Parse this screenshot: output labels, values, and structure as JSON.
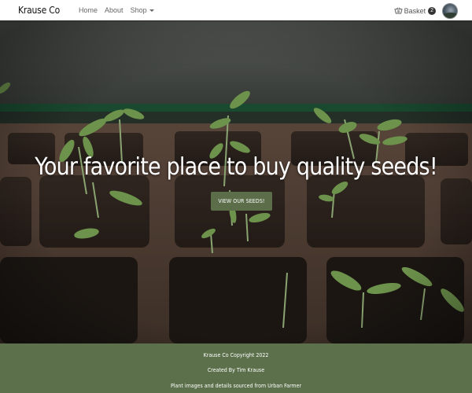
{
  "nav": {
    "brand": "Krause Co",
    "links": [
      "Home",
      "About",
      "Shop"
    ],
    "basket_label": "Basket",
    "basket_count": "2"
  },
  "hero": {
    "title": "Your favorite place to buy quality seeds!",
    "button_label": "VIEW OUR SEEDS!"
  },
  "footer": {
    "line1": "Krause Co Copyright 2022",
    "line2": "Created By Tim Krause",
    "line3": "Plant images and details sourced from Urban Farmer"
  },
  "colors": {
    "accent": "#5b6e49",
    "footer_bg": "#5b704b"
  },
  "icons": [
    "basket-icon",
    "chevron-down-icon"
  ]
}
